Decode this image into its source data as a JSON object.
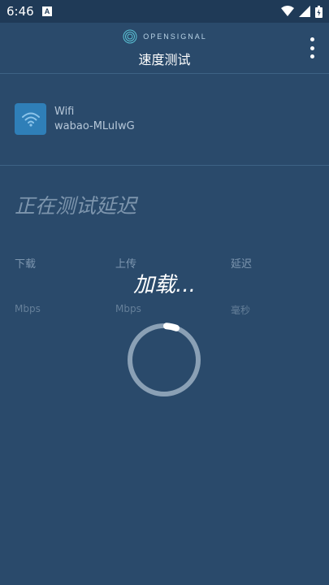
{
  "status_bar": {
    "time": "6:46",
    "notification_icon": "a-icon",
    "icons": [
      "wifi-icon",
      "signal-icon",
      "battery-icon"
    ]
  },
  "header": {
    "brand": "OPENSIGNAL",
    "title": "速度测试",
    "menu_icon": "more-vert-icon"
  },
  "network": {
    "icon": "wifi-icon",
    "type": "Wifi",
    "name": "wabao-MLuIwG"
  },
  "test": {
    "status": "正在测试延迟",
    "loading": "加载..."
  },
  "metrics": [
    {
      "label": "下载",
      "unit": "Mbps"
    },
    {
      "label": "上传",
      "unit": "Mbps"
    },
    {
      "label": "延迟",
      "unit": "毫秒"
    }
  ],
  "colors": {
    "background": "#2a4a6b",
    "status_bar": "#1f3a57",
    "wifi_tile": "#2f7fb8",
    "spinner_track": "#8aa0b5"
  }
}
